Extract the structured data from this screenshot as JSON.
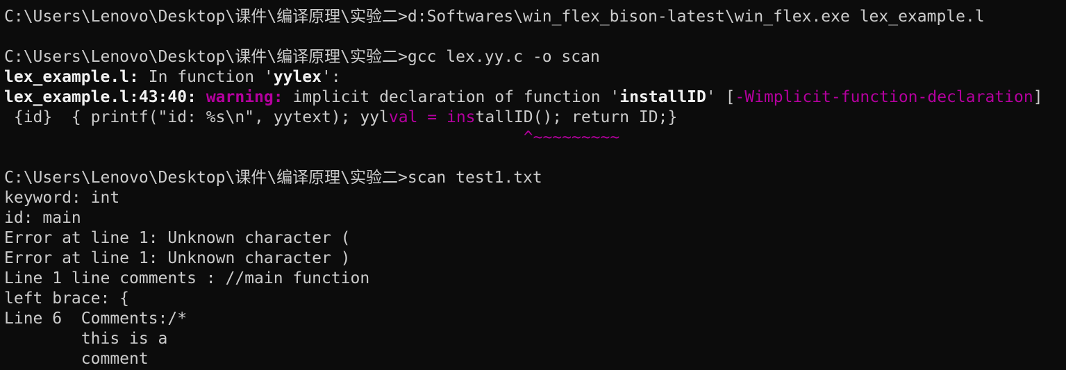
{
  "colors": {
    "background": "#0c0c0c",
    "foreground": "#cccccc",
    "bold_foreground": "#f2f2f2",
    "magenta": "#b4009e"
  },
  "terminal": {
    "cmd1": {
      "prompt": "C:\\Users\\Lenovo\\Desktop\\课件\\编译原理\\实验二>",
      "command": "d:Softwares\\win_flex_bison-latest\\win_flex.exe lex_example.l"
    },
    "blank1": "",
    "cmd2": {
      "prompt": "C:\\Users\\Lenovo\\Desktop\\课件\\编译原理\\实验二>",
      "command": "gcc lex.yy.c -o scan"
    },
    "diag1": {
      "file": "lex_example.l:",
      "text_a": " In function '",
      "func": "yylex",
      "text_b": "':"
    },
    "diag2": {
      "loc": "lex_example.l:43:40:",
      "sp1": " ",
      "warning": "warning:",
      "text_a": " implicit declaration of function '",
      "func": "installID",
      "text_b": "' [",
      "flag": "-Wimplicit-function-declaration",
      "text_c": "]"
    },
    "source": {
      "pre": " {id}  { printf(\"id: %s\\n\", yytext); yyl",
      "hl1": "val = ",
      "hl2": "ins",
      "post": "tallID(); return ID;}"
    },
    "caret": {
      "pad": "                                                      ",
      "mark": "^~~~~~~~~~"
    },
    "blank2": "",
    "cmd3": {
      "prompt": "C:\\Users\\Lenovo\\Desktop\\课件\\编译原理\\实验二>",
      "command": "scan test1.txt"
    },
    "output": [
      "keyword: int",
      "id: main",
      "Error at line 1: Unknown character (",
      "Error at line 1: Unknown character )",
      "Line 1 line comments : //main function",
      "left brace: {",
      "Line 6  Comments:/*",
      "        this is a",
      "        comment"
    ]
  }
}
